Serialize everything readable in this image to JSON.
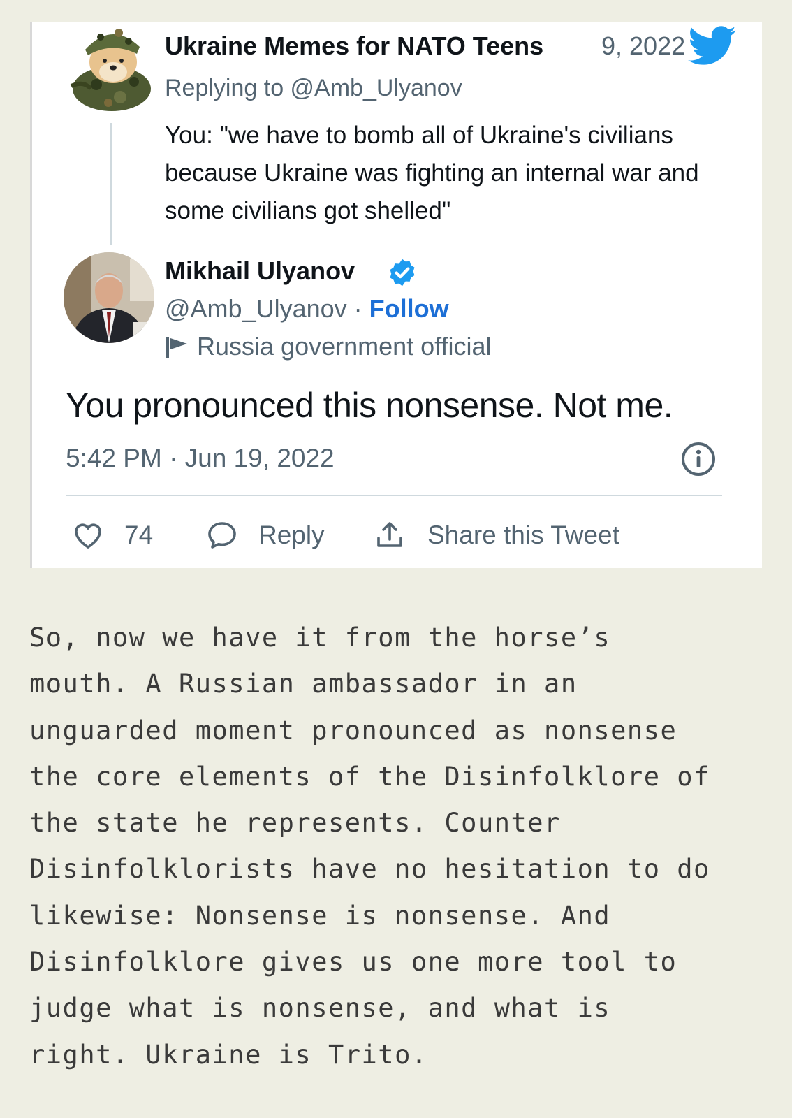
{
  "reply_tweet": {
    "author_name": "Ukraine Memes for NATO Teens",
    "date": "9, 2022",
    "replying_to": "Replying to @Amb_Ulyanov",
    "text": "You: \"we have to bomb all of Ukraine's civilians because Ukraine was fighting an internal war and some civilians got shelled\""
  },
  "main_tweet": {
    "author_name": "Mikhail Ulyanov",
    "handle": "@Amb_Ulyanov",
    "separator": " · ",
    "follow_label": "Follow",
    "account_label": "Russia government official",
    "text": "You pronounced this nonsense. Not me.",
    "timestamp": "5:42 PM · Jun 19, 2022",
    "likes": "74",
    "reply_label": "Reply",
    "share_label": "Share this Tweet"
  },
  "essay_lines": [
    "So, now we have it from the horse’s",
    "mouth. A Russian ambassador in an",
    "unguarded moment pronounced as nonsense",
    "the core elements of the Disinfolklore of",
    "the state he represents. Counter",
    "Disinfolklorists have no hesitation to do",
    "likewise: Nonsense is nonsense. And",
    "Disinfolklore gives us one more tool to",
    "judge what is nonsense, and what is",
    "right. Ukraine is Trito."
  ],
  "colors": {
    "page_background": "#eeeee3",
    "twitter_blue": "#1d9bf0",
    "follow_blue": "#1d6fd6",
    "secondary_text": "#536471"
  },
  "icons": {
    "brand": "twitter-bird-icon",
    "verified": "verified-badge-icon",
    "label": "flag-icon",
    "info": "info-icon",
    "like": "heart-icon",
    "reply": "speech-bubble-icon",
    "share": "share-upload-icon"
  }
}
